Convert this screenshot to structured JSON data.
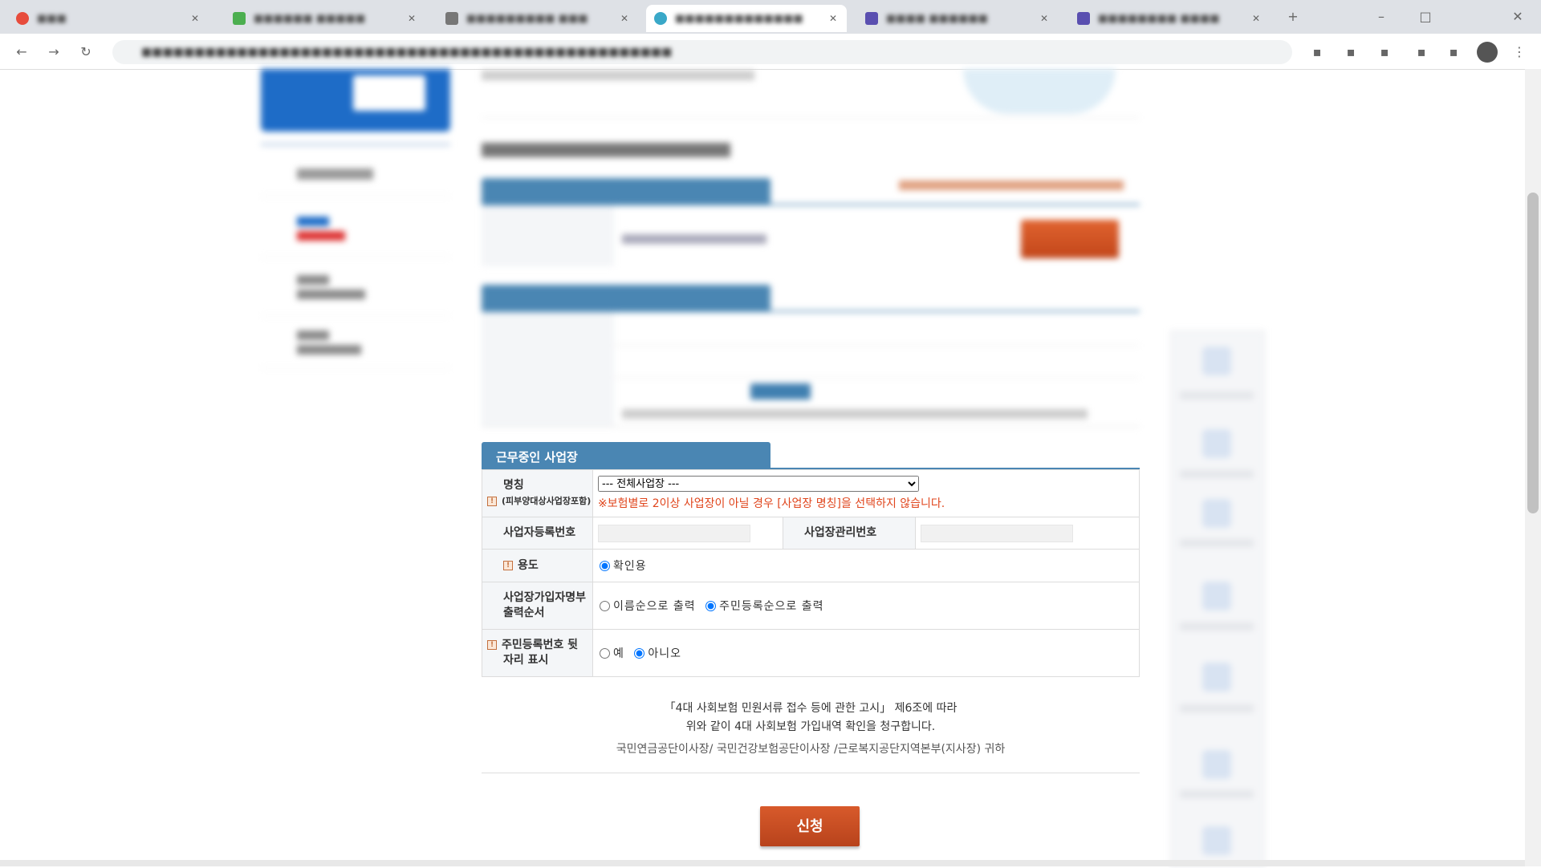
{
  "section_title": "근무중인 사업장",
  "table": {
    "name_label": "명칭",
    "name_sub": "(피부양대상사업장포함)",
    "select_value": "--- 전체사업장 ---",
    "name_note": "※보험별로 2이상 사업장이 아닐 경우 [사업장 명칭]을 선택하지 않습니다.",
    "bizno_label": "사업자등록번호",
    "mgmtno_label": "사업장관리번호",
    "purpose_label": "용도",
    "purpose_option": "확인용",
    "order_label_1": "사업장가입자명부",
    "order_label_2": "출력순서",
    "order_opt_name": "이름순으로 출력",
    "order_opt_id": "주민등록순으로 출력",
    "rrn_label_1": "주민등록번호 뒷",
    "rrn_label_2": "자리 표시",
    "rrn_yes": "예",
    "rrn_no": "아니오"
  },
  "declaration": {
    "line1": "「4대 사회보험 민원서류 접수 등에 관한 고시」 제6조에 따라",
    "line2": "위와 같이 4대 사회보험 가입내역 확인을 청구합니다.",
    "line3": "국민연금공단이사장/ 국민건강보험공단이사장 /근로복지공단지역본부(지사장) 귀하"
  },
  "submit_label": "신청",
  "colors": {
    "accent": "#4a86b3",
    "button": "#c84b1f",
    "note": "#e0451c"
  }
}
